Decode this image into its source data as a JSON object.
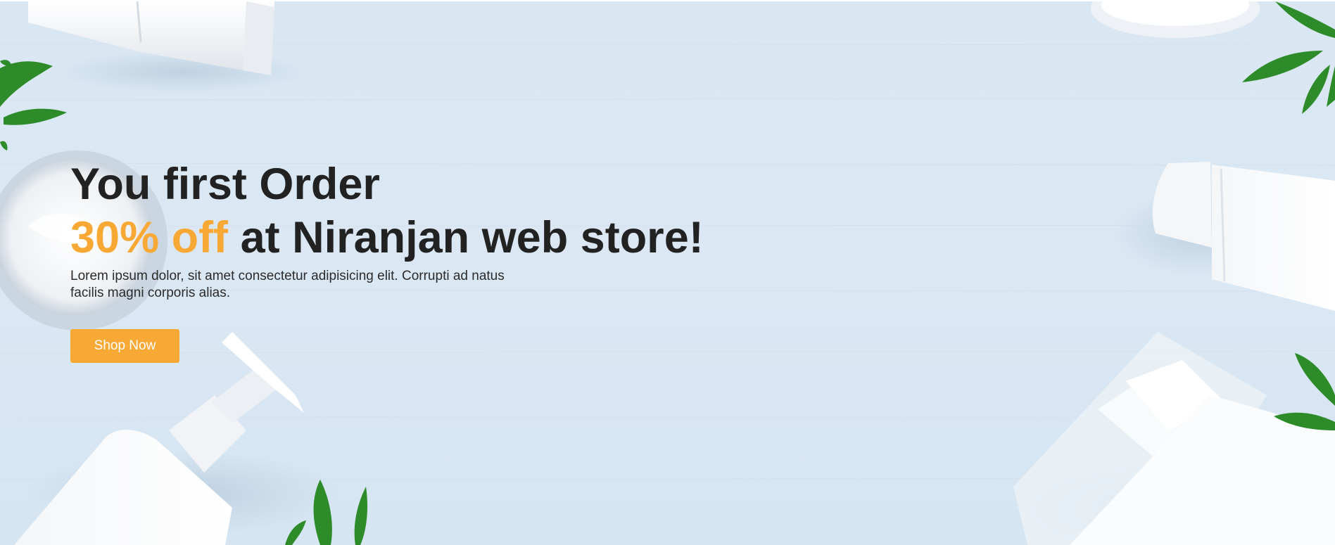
{
  "hero": {
    "heading_line1": "You first Order",
    "heading_highlight": "30% off",
    "heading_rest": "at Niranjan web store!",
    "description": "Lorem ipsum dolor, sit amet consectetur adipisicing elit. Corrupti ad natus facilis magni corporis alias.",
    "cta_label": "Shop Now"
  },
  "colors": {
    "accent": "#f8a935",
    "heading": "#222222",
    "background": "#d9e7f3"
  },
  "decor": {
    "icons": [
      "tube-icon",
      "cream-jar-icon",
      "pump-bottle-icon",
      "leaf-icon",
      "bottle-icon"
    ]
  }
}
